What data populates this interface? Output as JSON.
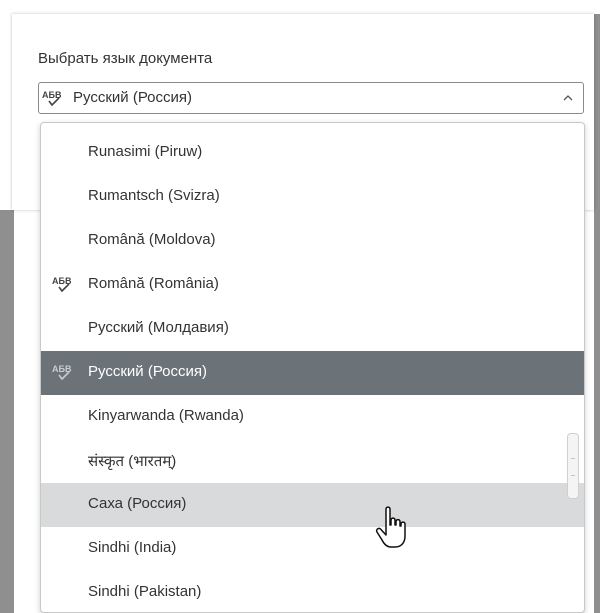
{
  "dialog": {
    "label": "Выбрать язык документа",
    "selected_value": "Русский (Россия)"
  },
  "dropdown": {
    "options": [
      {
        "label": "Runasimi (Piruw)",
        "spellcheck": false,
        "state": "normal"
      },
      {
        "label": "Rumantsch (Svizra)",
        "spellcheck": false,
        "state": "normal"
      },
      {
        "label": "Română (Moldova)",
        "spellcheck": false,
        "state": "normal"
      },
      {
        "label": "Română (România)",
        "spellcheck": true,
        "state": "normal"
      },
      {
        "label": "Русский (Молдавия)",
        "spellcheck": false,
        "state": "normal"
      },
      {
        "label": "Русский (Россия)",
        "spellcheck": true,
        "state": "selected"
      },
      {
        "label": "Kinyarwanda (Rwanda)",
        "spellcheck": false,
        "state": "normal"
      },
      {
        "label": "संस्कृत (भारतम्)",
        "spellcheck": false,
        "state": "normal"
      },
      {
        "label": "Саха (Россия)",
        "spellcheck": false,
        "state": "hover"
      },
      {
        "label": "Sindhi (India)",
        "spellcheck": false,
        "state": "normal"
      },
      {
        "label": "Sindhi (Pakistan)",
        "spellcheck": false,
        "state": "normal"
      }
    ]
  },
  "icons": {
    "spellcheck": "spellcheck-abc-icon",
    "chevron": "chevron-up-icon",
    "cursor": "hand-pointer-icon"
  },
  "colors": {
    "selected_bg": "#6b7278",
    "hover_bg": "#d8dadc",
    "text": "#333333"
  }
}
